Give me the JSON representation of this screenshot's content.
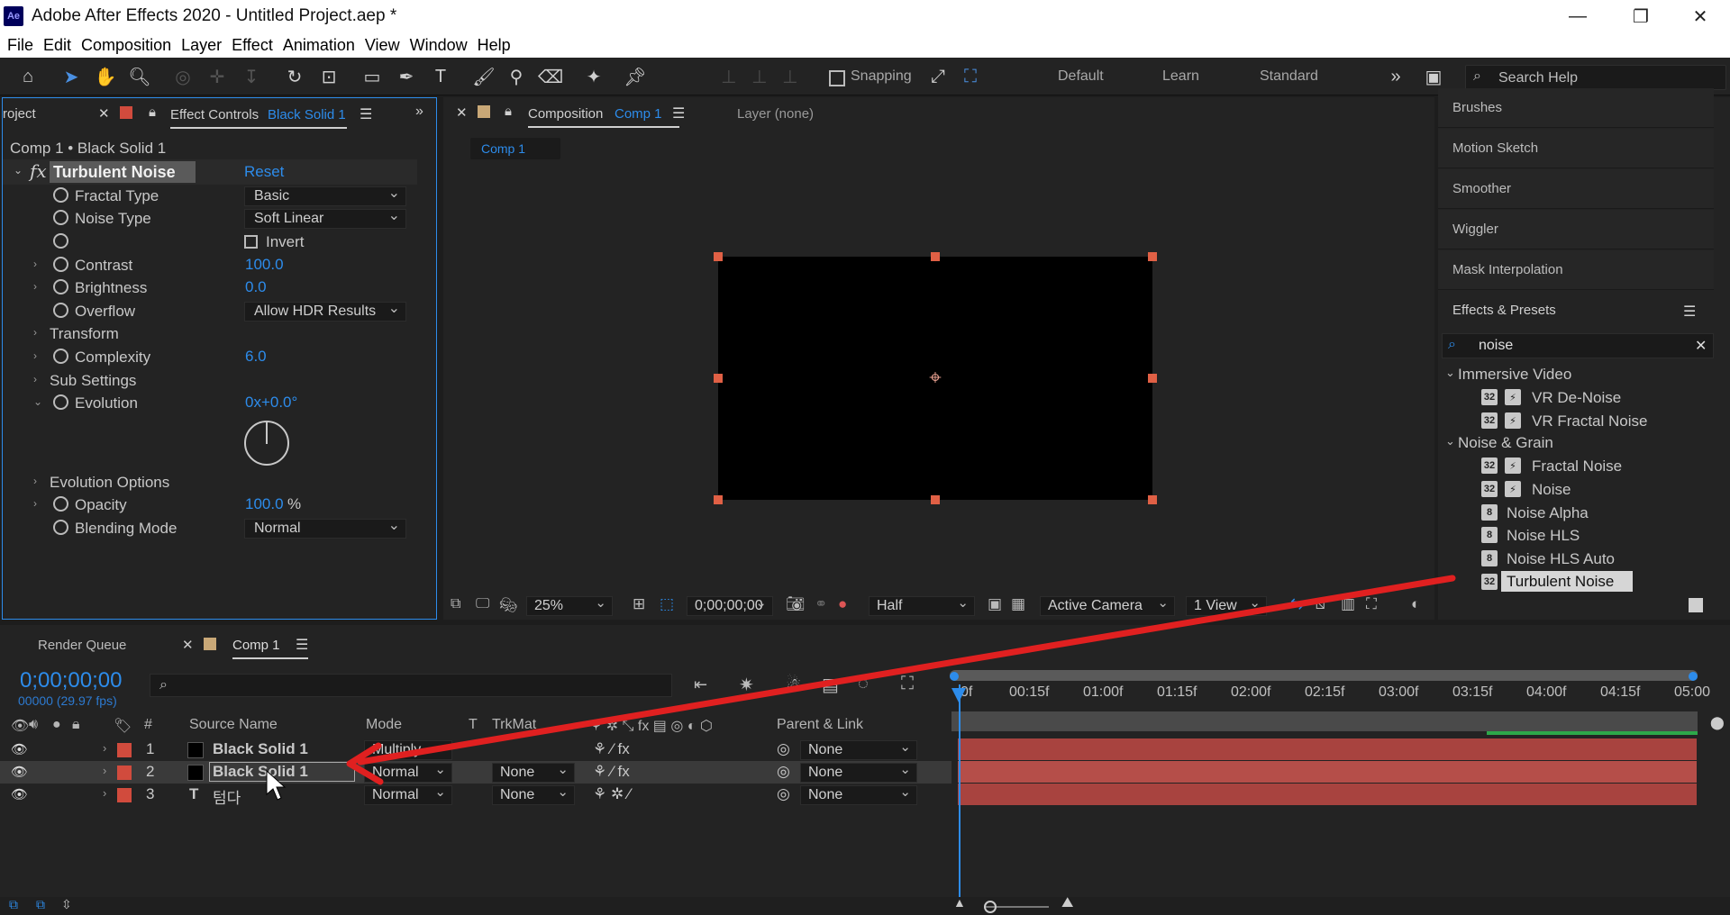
{
  "window": {
    "app_icon": "Ae",
    "title": "Adobe After Effects 2020 - Untitled Project.aep *"
  },
  "menu": [
    "File",
    "Edit",
    "Composition",
    "Layer",
    "Effect",
    "Animation",
    "View",
    "Window",
    "Help"
  ],
  "toolbar": {
    "snapping": "Snapping",
    "workspaces": [
      "Default",
      "Learn",
      "Standard"
    ],
    "search_placeholder": "Search Help"
  },
  "effect_controls": {
    "project_tab": "roject",
    "tab_label": "Effect Controls",
    "tab_layer": "Black Solid 1",
    "breadcrumb": "Comp 1 • Black Solid 1",
    "effect_name": "Turbulent Noise",
    "reset": "Reset",
    "fx_glyph": "fx",
    "props": {
      "fractal_type": {
        "label": "Fractal Type",
        "value": "Basic"
      },
      "noise_type": {
        "label": "Noise Type",
        "value": "Soft Linear"
      },
      "invert": {
        "label": "Invert"
      },
      "contrast": {
        "label": "Contrast",
        "value": "100.0"
      },
      "brightness": {
        "label": "Brightness",
        "value": "0.0"
      },
      "overflow": {
        "label": "Overflow",
        "value": "Allow HDR Results"
      },
      "transform": {
        "label": "Transform"
      },
      "complexity": {
        "label": "Complexity",
        "value": "6.0"
      },
      "sub_settings": {
        "label": "Sub Settings"
      },
      "evolution": {
        "label": "Evolution",
        "value": "0x+0.0°"
      },
      "evolution_options": {
        "label": "Evolution Options"
      },
      "opacity": {
        "label": "Opacity",
        "value": "100.0",
        "unit": "%"
      },
      "blending_mode": {
        "label": "Blending Mode",
        "value": "Normal"
      }
    }
  },
  "composition": {
    "tab_label": "Composition",
    "tab_comp": "Comp 1",
    "layer_tab": "Layer (none)",
    "flow_tab": "Comp 1",
    "zoom": "25%",
    "timecode": "0;00;00;00",
    "resolution": "Half",
    "camera": "Active Camera",
    "views": "1 View"
  },
  "right_panel": {
    "sections": [
      "Brushes",
      "Motion Sketch",
      "Smoother",
      "Wiggler",
      "Mask Interpolation"
    ],
    "effects_title": "Effects & Presets",
    "search_value": "noise",
    "groups": [
      {
        "name": "Immersive Video",
        "items": [
          "VR De-Noise",
          "VR Fractal Noise"
        ]
      },
      {
        "name": "Noise & Grain",
        "items": [
          "Fractal Noise",
          "Noise",
          "Noise Alpha",
          "Noise HLS",
          "Noise HLS Auto",
          "Turbulent Noise"
        ]
      }
    ],
    "badge_32": "32",
    "badge_8": "8"
  },
  "timeline": {
    "render_queue": "Render Queue",
    "comp_tab": "Comp 1",
    "timecode": "0;00;00;00",
    "fps": "00000 (29.97 fps)",
    "columns": {
      "num": "#",
      "source": "Source Name",
      "mode": "Mode",
      "t": "T",
      "trkmat": "TrkMat",
      "parent": "Parent & Link"
    },
    "ruler": [
      "0f",
      "00:15f",
      "01:00f",
      "01:15f",
      "02:00f",
      "02:15f",
      "03:00f",
      "03:15f",
      "04:00f",
      "04:15f",
      "05:00"
    ],
    "layers": [
      {
        "num": "1",
        "name": "Black Solid 1",
        "mode": "Multiply",
        "trkmat": "",
        "parent": "None"
      },
      {
        "num": "2",
        "name": "Black Solid 1",
        "mode": "Normal",
        "trkmat": "None",
        "parent": "None"
      },
      {
        "num": "3",
        "name": "텀다",
        "mode": "Normal",
        "trkmat": "None",
        "parent": "None"
      }
    ]
  }
}
